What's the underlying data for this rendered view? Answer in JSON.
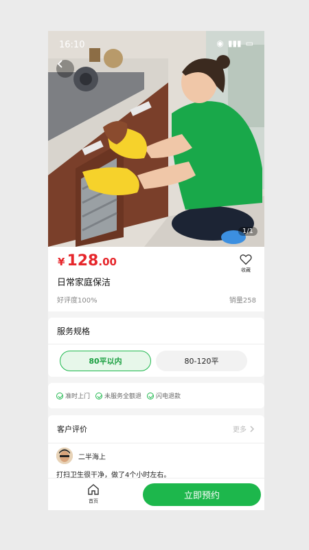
{
  "status_bar": {
    "time": "16:10"
  },
  "hero": {
    "counter": "1/1"
  },
  "price": {
    "currency": "¥",
    "main": "128",
    "decimal": ".00"
  },
  "favorite": {
    "label": "收藏"
  },
  "service": {
    "title": "日常家庭保洁",
    "rating": "好评度100%",
    "sales": "销量258"
  },
  "spec": {
    "title": "服务规格",
    "options": [
      "80平以内",
      "80-120平"
    ],
    "selected": "80平以内"
  },
  "guarantees": [
    "准时上门",
    "未服务全额退",
    "闪电退款"
  ],
  "reviews": {
    "title": "客户评价",
    "more": "更多",
    "items": [
      {
        "user": "二半海上",
        "text": "打扫卫生很干净，做了4个小时左右。"
      }
    ]
  },
  "bottom_bar": {
    "home_label": "首页",
    "book_label": "立即预约"
  },
  "colors": {
    "accent": "#1db74c",
    "price": "#e6262b"
  }
}
